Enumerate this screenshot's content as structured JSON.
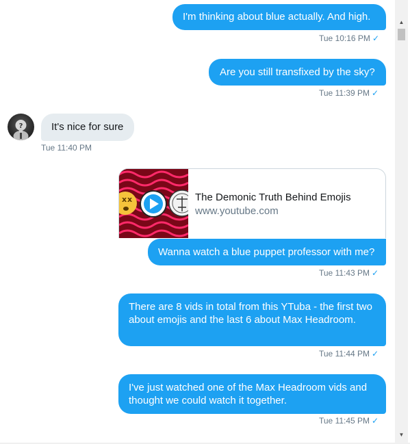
{
  "messages": [
    {
      "text": "I'm thinking about blue actually. And high.",
      "time": "Tue 10:16 PM"
    },
    {
      "text": "Are you still transfixed by the sky?",
      "time": "Tue 11:39 PM"
    },
    {
      "text": "It's nice for sure",
      "time": "Tue 11:40 PM"
    },
    {
      "text": "Wanna watch a blue puppet professor with me?",
      "time": "Tue 11:43 PM",
      "card": {
        "title": "The Demonic Truth Behind Emojis",
        "domain": "www.youtube.com"
      }
    },
    {
      "text": "There are 8 vids in total from this  YTuba - the first two about emojis and the last 6 about Max Headroom.",
      "time": "Tue 11:44 PM"
    },
    {
      "text": "I've just watched one of the Max Headroom vids and thought we could watch it together.",
      "time": "Tue 11:45 PM"
    }
  ],
  "read_receipt_icon": "checkmark-icon",
  "colors": {
    "outgoing_bubble": "#1da1f2",
    "incoming_bubble": "#e6ecf0",
    "timestamp": "#657786"
  }
}
